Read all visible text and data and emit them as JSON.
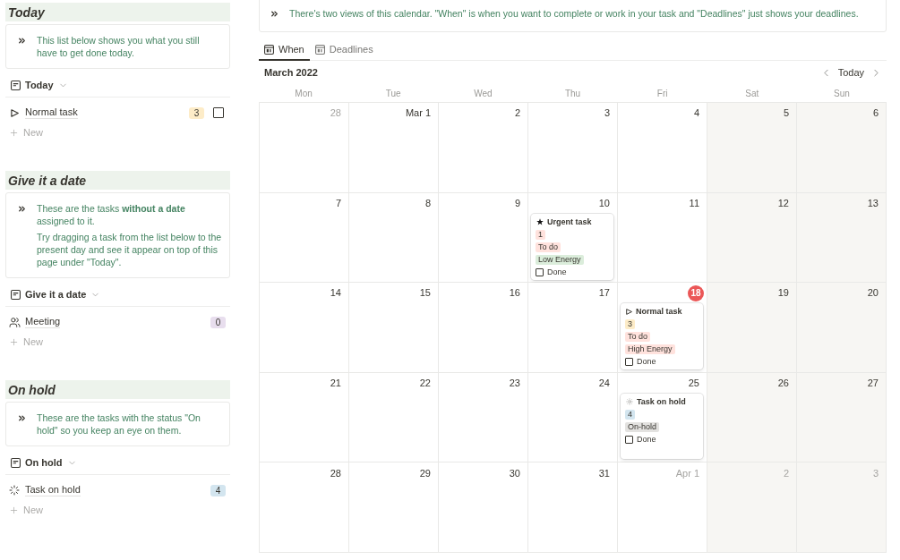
{
  "sections": [
    {
      "heading": "Today",
      "callout": [
        "This list below shows you what you still have to get done today."
      ],
      "view": "Today",
      "rows": [
        {
          "kind": "normal",
          "title": "Normal task",
          "badge": {
            "label": "3",
            "color": "#fdecc8"
          },
          "checked": false
        }
      ],
      "new_label": "New"
    },
    {
      "heading": "Give it a date",
      "callout": [
        "These are the tasks **without a date** assigned to it.",
        "Try dragging a task from the list below to the present day and see it appear on top of this page under \"Today\"."
      ],
      "view": "Give it a date",
      "rows": [
        {
          "kind": "meeting",
          "title": "Meeting",
          "badge": {
            "label": "0",
            "color": "#e8deee"
          }
        }
      ],
      "new_label": "New"
    },
    {
      "heading": "On hold",
      "callout": [
        "These are the tasks with the status \"On hold\" so you keep an eye on them."
      ],
      "view": "On hold",
      "rows": [
        {
          "kind": "on_hold",
          "title": "Task on hold",
          "badge": {
            "label": "4",
            "color": "#d3e5ef"
          }
        }
      ],
      "new_label": "New"
    }
  ],
  "calendar": {
    "callout": "There's two views of this calendar. \"When\" is when you want to complete or work in your task and \"Deadlines\" just shows your deadlines.",
    "tabs": [
      {
        "label": "When",
        "selected": true
      },
      {
        "label": "Deadlines",
        "selected": false
      }
    ],
    "month": "March 2022",
    "today_button": "Today",
    "weekdays": [
      "Mon",
      "Tue",
      "Wed",
      "Thu",
      "Fri",
      "Sat",
      "Sun"
    ],
    "weeks": [
      {
        "days": [
          {
            "label": "28",
            "other_month": true,
            "today": false
          },
          {
            "label": "Mar 1",
            "other_month": false,
            "today": false
          },
          {
            "label": "2",
            "other_month": false,
            "today": false
          },
          {
            "label": "3",
            "other_month": false,
            "today": false
          },
          {
            "label": "4",
            "other_month": false,
            "today": false
          },
          {
            "label": "5",
            "other_month": false,
            "today": false
          },
          {
            "label": "6",
            "other_month": false,
            "today": false
          }
        ]
      },
      {
        "days": [
          {
            "label": "7",
            "other_month": false,
            "today": false
          },
          {
            "label": "8",
            "other_month": false,
            "today": false
          },
          {
            "label": "9",
            "other_month": false,
            "today": false
          },
          {
            "label": "10",
            "other_month": false,
            "today": false,
            "cards": [
              {
                "kind": "urgent",
                "title": "Urgent task",
                "tags": [
                  {
                    "label": "1",
                    "color": "#ffe2dd"
                  },
                  {
                    "label": "To do",
                    "color": "#ffe2dd"
                  },
                  {
                    "label": "Low Energy",
                    "color": "#dbeddb"
                  }
                ],
                "checkbox": {
                  "label": "Done",
                  "checked": false
                }
              }
            ]
          },
          {
            "label": "11",
            "other_month": false,
            "today": false
          },
          {
            "label": "12",
            "other_month": false,
            "today": false
          },
          {
            "label": "13",
            "other_month": false,
            "today": false
          }
        ]
      },
      {
        "days": [
          {
            "label": "14",
            "other_month": false,
            "today": false
          },
          {
            "label": "15",
            "other_month": false,
            "today": false
          },
          {
            "label": "16",
            "other_month": false,
            "today": false
          },
          {
            "label": "17",
            "other_month": false,
            "today": false
          },
          {
            "label": "18",
            "other_month": false,
            "today": true,
            "cards": [
              {
                "kind": "normal",
                "title": "Normal task",
                "tags": [
                  {
                    "label": "3",
                    "color": "#fdecc8"
                  },
                  {
                    "label": "To do",
                    "color": "#ffe2dd"
                  },
                  {
                    "label": "High Energy",
                    "color": "#ffe2dd"
                  }
                ],
                "checkbox": {
                  "label": "Done",
                  "checked": false
                }
              }
            ]
          },
          {
            "label": "19",
            "other_month": false,
            "today": false
          },
          {
            "label": "20",
            "other_month": false,
            "today": false
          }
        ]
      },
      {
        "days": [
          {
            "label": "21",
            "other_month": false,
            "today": false
          },
          {
            "label": "22",
            "other_month": false,
            "today": false
          },
          {
            "label": "23",
            "other_month": false,
            "today": false
          },
          {
            "label": "24",
            "other_month": false,
            "today": false
          },
          {
            "label": "25",
            "other_month": false,
            "today": false,
            "cards": [
              {
                "kind": "on_hold",
                "title": "Task on hold",
                "tags": [
                  {
                    "label": "4",
                    "color": "#d3e5ef"
                  },
                  {
                    "label": "On-hold",
                    "color": "#e3e2e0"
                  }
                ],
                "checkbox": {
                  "label": "Done",
                  "checked": false
                }
              }
            ]
          },
          {
            "label": "26",
            "other_month": false,
            "today": false
          },
          {
            "label": "27",
            "other_month": false,
            "today": false
          }
        ]
      },
      {
        "days": [
          {
            "label": "28",
            "other_month": false,
            "today": false
          },
          {
            "label": "29",
            "other_month": false,
            "today": false
          },
          {
            "label": "30",
            "other_month": false,
            "today": false
          },
          {
            "label": "31",
            "other_month": false,
            "today": false
          },
          {
            "label": "Apr 1",
            "other_month": true,
            "today": false
          },
          {
            "label": "2",
            "other_month": true,
            "today": false
          },
          {
            "label": "3",
            "other_month": true,
            "today": false
          }
        ]
      }
    ]
  }
}
